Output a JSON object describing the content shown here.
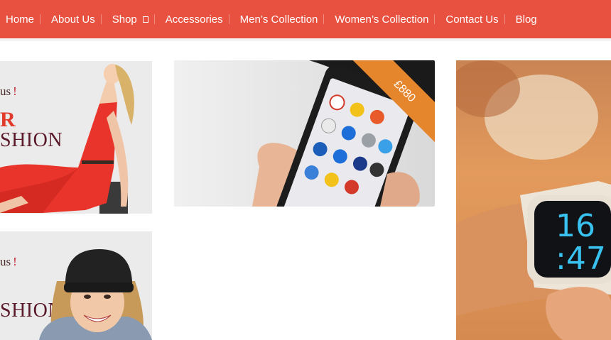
{
  "nav": {
    "items": [
      {
        "label": "Home"
      },
      {
        "label": "About Us"
      },
      {
        "label": "Shop"
      },
      {
        "label": "Accessories"
      },
      {
        "label": "Men’s Collection"
      },
      {
        "label": "Women’s Collection"
      },
      {
        "label": "Contact Us"
      },
      {
        "label": "Blog"
      }
    ]
  },
  "banners": [
    {
      "tag": "us",
      "excl": "!",
      "accent": "R",
      "headline": "SHION"
    },
    {
      "tag": "us",
      "excl": "!",
      "headline": "SHION"
    }
  ],
  "products": {
    "phone": {
      "price": "£880"
    },
    "watch": {
      "hours": "16",
      "minutes": ":47"
    }
  },
  "colors": {
    "nav_bg": "#e8503f",
    "ribbon": "#e6862c",
    "dress": "#e8342a"
  }
}
